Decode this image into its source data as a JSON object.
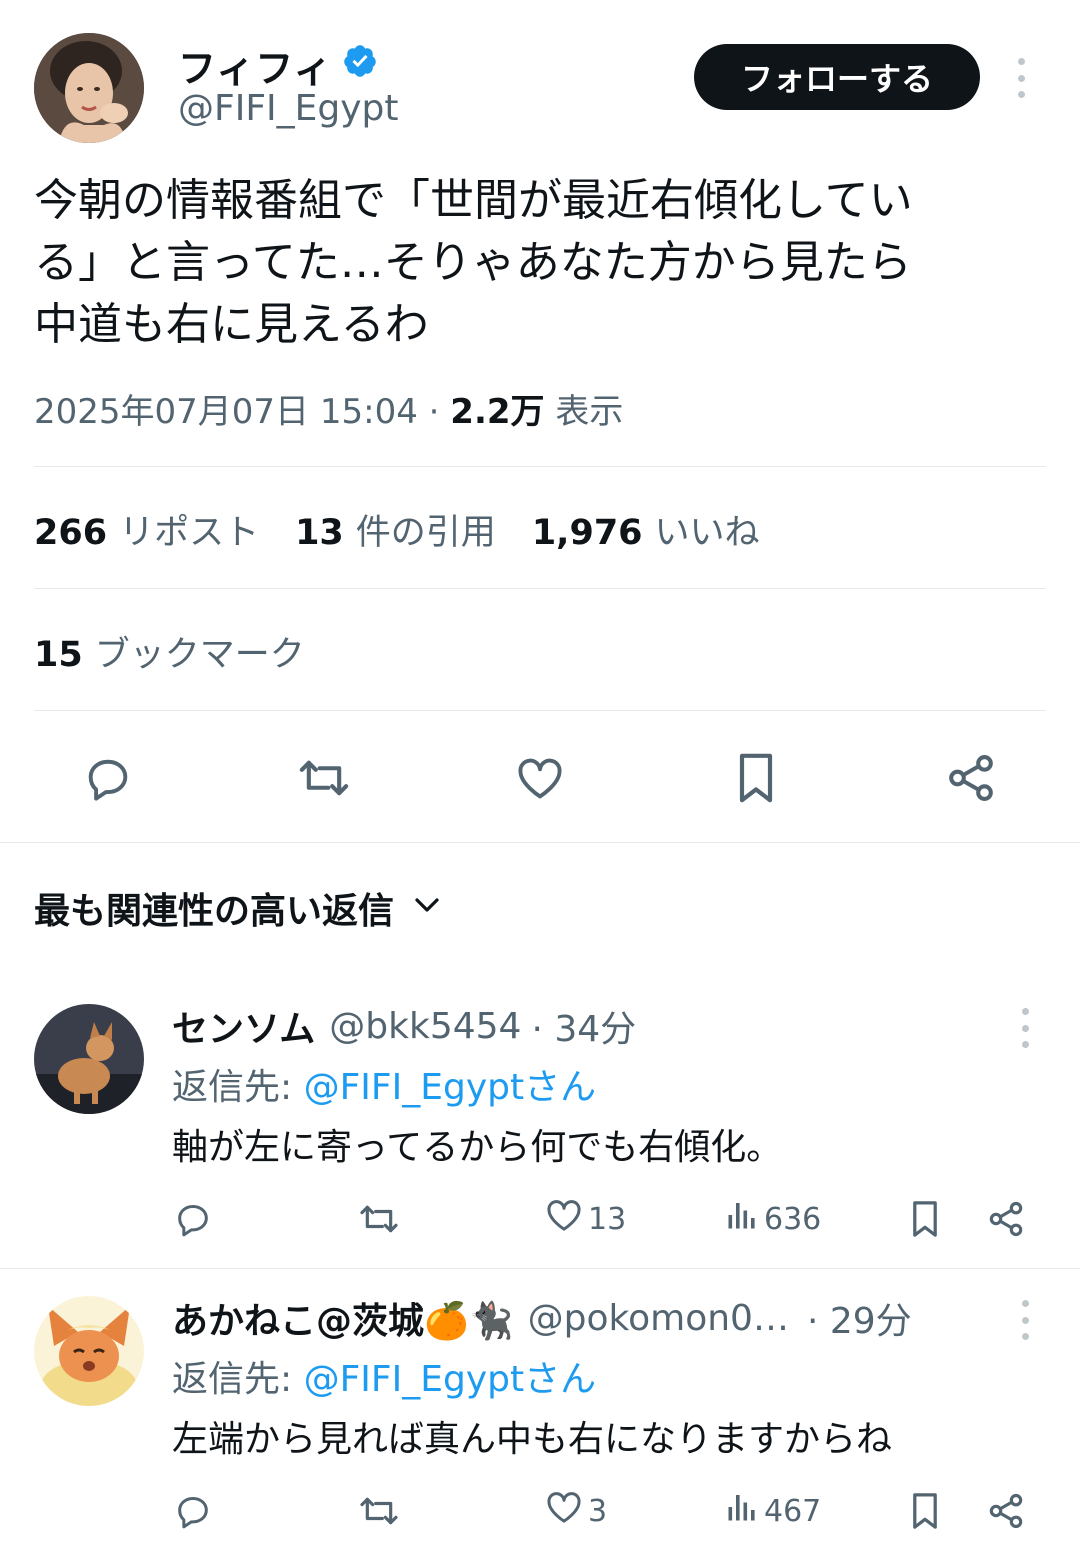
{
  "tweet": {
    "display_name": "フィフィ",
    "handle": "@FIFI_Egypt",
    "follow_label": "フォローする",
    "text_lines": [
      "今朝の情報番組で「世間が最近右傾化してい",
      "る」と言ってた…そりゃあなた方から見たら",
      "中道も右に見えるわ"
    ],
    "datetime": "2025年07月07日 15:04",
    "views_value": "2.2万",
    "views_label": "表示",
    "stats": {
      "reposts_value": "266",
      "reposts_label": "リポスト",
      "quotes_value": "13",
      "quotes_label": "件の引用",
      "likes_value": "1,976",
      "likes_label": "いいね",
      "bookmarks_value": "15",
      "bookmarks_label": "ブックマーク"
    },
    "actions": [
      "reply-icon",
      "repost-icon",
      "like-icon",
      "bookmark-icon",
      "share-icon"
    ]
  },
  "replies_header": {
    "label": "最も関連性の高い返信"
  },
  "replies": [
    {
      "name": "センソム",
      "handle": "@bkk5454",
      "time": "· 34分",
      "reply_to_prefix": "返信先: ",
      "reply_to": "@FIFI_Egyptさん",
      "text": "軸が左に寄ってるから何でも右傾化。",
      "likes": "13",
      "views": "636"
    },
    {
      "name": "あかねこ@茨城🍊🐈‍⬛",
      "handle": "@pokomon0…",
      "time": "· 29分",
      "reply_to_prefix": "返信先: ",
      "reply_to": "@FIFI_Egyptさん",
      "text": "左端から見れば真ん中も右になりますからね",
      "likes": "3",
      "views": "467"
    }
  ],
  "colors": {
    "text": "#0f1419",
    "secondary": "#536471",
    "link": "#1d9bf0",
    "verified": "#1d9bf0",
    "divider": "#e6e9eb"
  }
}
